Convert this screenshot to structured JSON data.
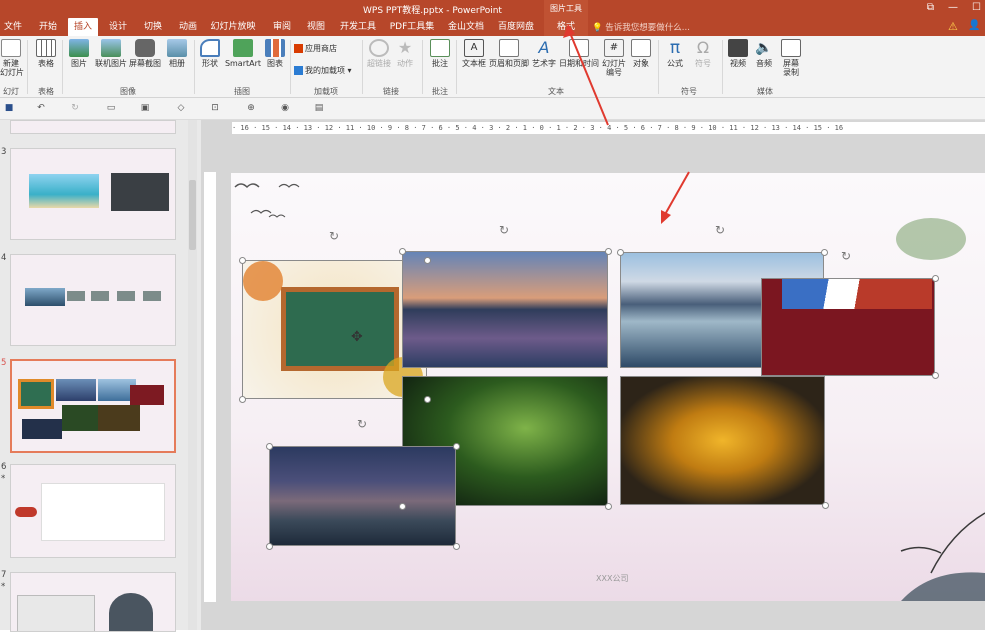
{
  "app": {
    "title": "WPS PPT教程.pptx - PowerPoint",
    "context_tab_group": "图片工具"
  },
  "tabs": [
    "文件",
    "开始",
    "插入",
    "设计",
    "切换",
    "动画",
    "幻灯片放映",
    "审阅",
    "视图",
    "开发工具",
    "PDF工具集",
    "金山文档",
    "百度网盘",
    "格式"
  ],
  "active_tab": "插入",
  "tell_me": "告诉我您想要做什么...",
  "ribbon": {
    "buttons": [
      {
        "label": "新建\n幻灯片",
        "icon": "new-slide-icon"
      },
      {
        "label": "表格",
        "icon": "table-icon"
      },
      {
        "label": "图片",
        "icon": "picture-icon"
      },
      {
        "label": "联机图片",
        "icon": "online-picture-icon"
      },
      {
        "label": "屏幕截图",
        "icon": "screenshot-icon"
      },
      {
        "label": "相册",
        "icon": "album-icon"
      },
      {
        "label": "形状",
        "icon": "shapes-icon"
      },
      {
        "label": "SmartArt",
        "icon": "smartart-icon"
      },
      {
        "label": "图表",
        "icon": "chart-icon"
      },
      {
        "label": "应用商店",
        "icon": "store-icon"
      },
      {
        "label": "我的加载项",
        "icon": "addins-icon"
      },
      {
        "label": "超链接",
        "icon": "hyperlink-icon"
      },
      {
        "label": "动作",
        "icon": "action-icon"
      },
      {
        "label": "批注",
        "icon": "comment-icon"
      },
      {
        "label": "文本框",
        "icon": "textbox-icon"
      },
      {
        "label": "页眉和页脚",
        "icon": "header-footer-icon"
      },
      {
        "label": "艺术字",
        "icon": "wordart-icon"
      },
      {
        "label": "日期和时间",
        "icon": "datetime-icon"
      },
      {
        "label": "幻灯片\n编号",
        "icon": "slide-number-icon"
      },
      {
        "label": "对象",
        "icon": "object-icon"
      },
      {
        "label": "公式",
        "icon": "equation-icon"
      },
      {
        "label": "符号",
        "icon": "symbol-icon"
      },
      {
        "label": "视频",
        "icon": "video-icon"
      },
      {
        "label": "音频",
        "icon": "audio-icon"
      },
      {
        "label": "屏幕\n录制",
        "icon": "screen-record-icon"
      }
    ],
    "groups": [
      "幻灯片",
      "表格",
      "图像",
      "插图",
      "加载项",
      "链接",
      "批注",
      "文本",
      "符号",
      "媒体"
    ]
  },
  "slides_panel": {
    "numbers": [
      "3",
      "4",
      "5",
      "6",
      "7"
    ],
    "star_marks": [
      "*",
      "*"
    ],
    "selected": "5"
  },
  "slide": {
    "footer": "XXX公司"
  },
  "colors": {
    "accent": "#b7472a",
    "selection": "#e57b5a",
    "annotation_arrow": "#e03a2f"
  }
}
